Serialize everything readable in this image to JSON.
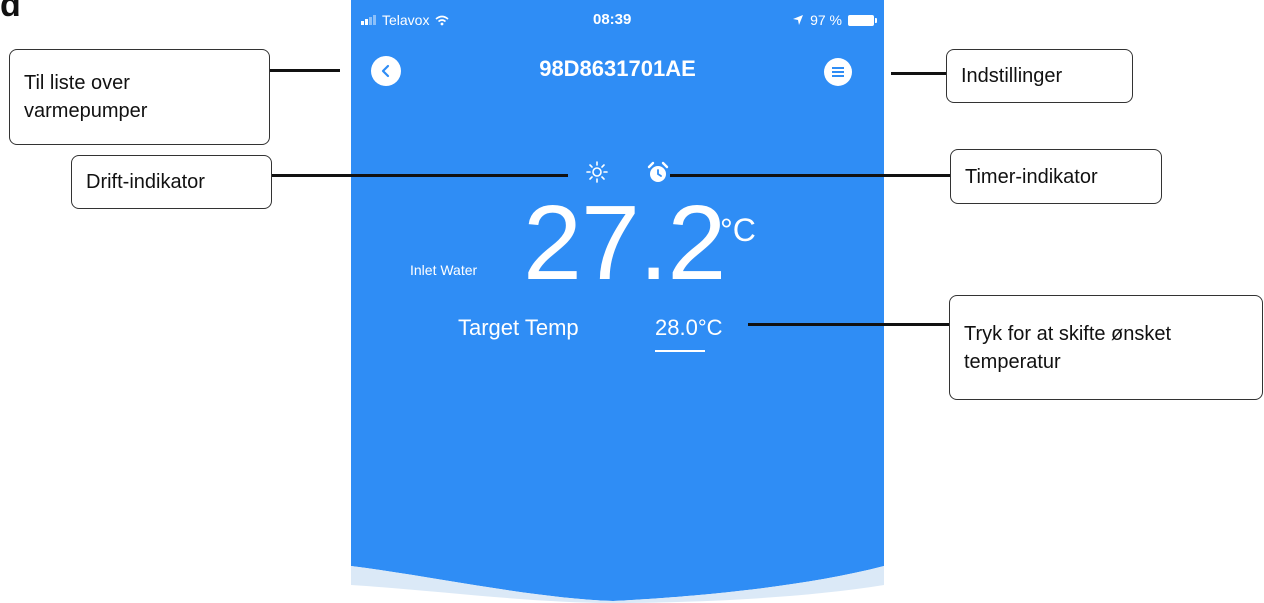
{
  "corner_label": "d",
  "colors": {
    "screen_blue": "#2f8df5",
    "wave_light": "#dbe9f7",
    "text": "#ffffff"
  },
  "status_bar": {
    "carrier": "Telavox",
    "time": "08:39",
    "battery": "97 %"
  },
  "header": {
    "title": "98D8631701AE",
    "back_icon": "chevron-left-icon",
    "menu_icon": "menu-icon"
  },
  "indicators": {
    "operation_icon": "sun-icon",
    "timer_icon": "alarm-clock-icon"
  },
  "main": {
    "inlet_label": "Inlet Water",
    "inlet_temp": "27.2",
    "inlet_unit": "°C",
    "target_label": "Target Temp",
    "target_value": "28.0°C"
  },
  "callouts": {
    "back": "Til liste over varmepumper",
    "settings": "Indstillinger",
    "operation": "Drift-indikator",
    "timer": "Timer-indikator",
    "target": "Tryk for at skifte ønsket temperatur"
  }
}
